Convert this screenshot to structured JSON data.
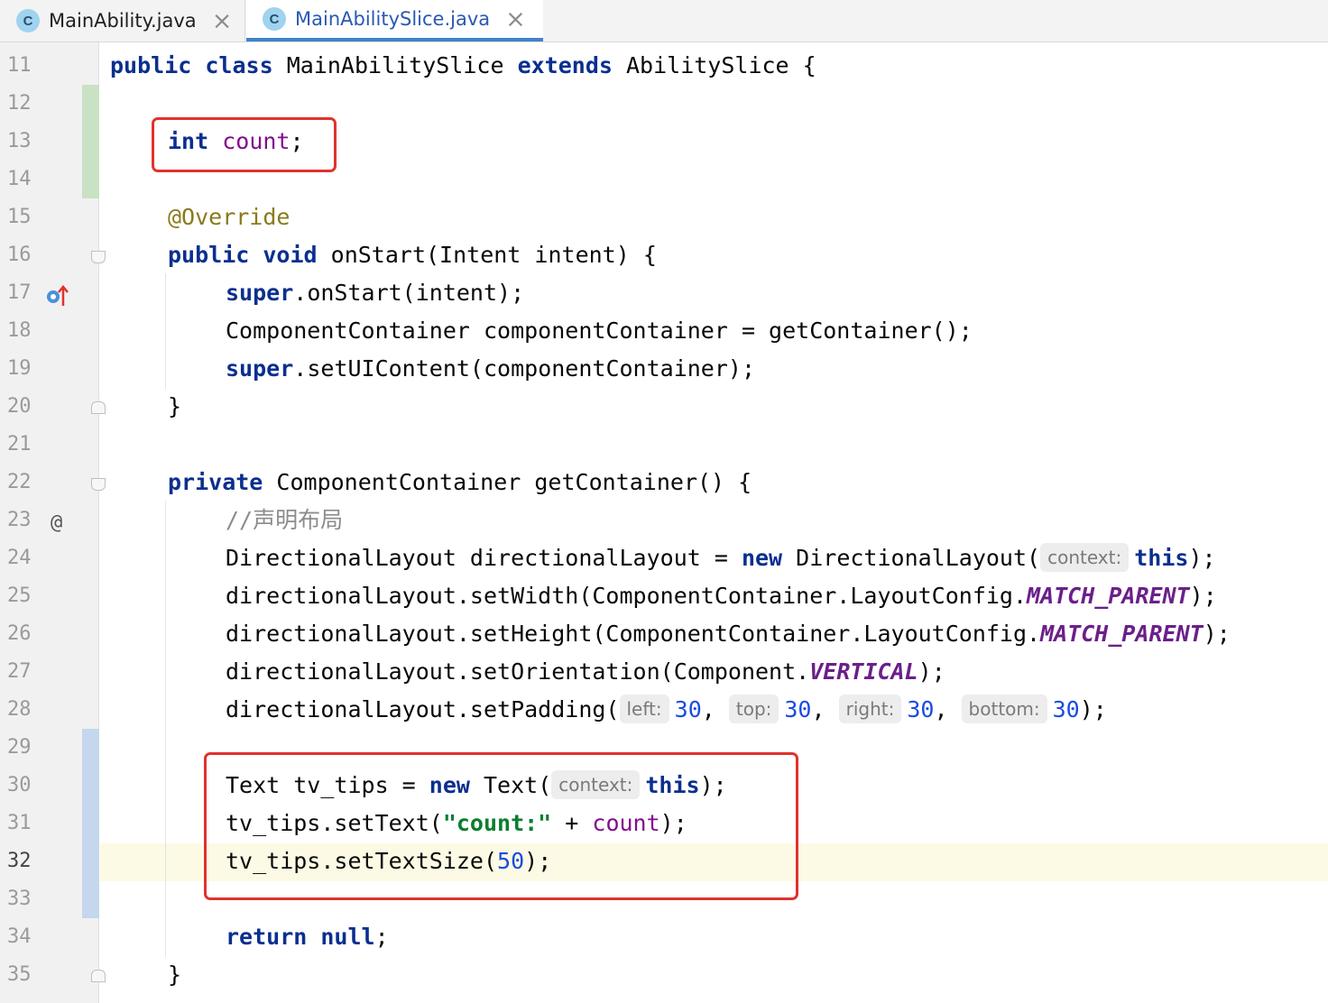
{
  "tabs": [
    {
      "label": "MainAbility.java",
      "icon": "C",
      "active": false
    },
    {
      "label": "MainAbilitySlice.java",
      "icon": "C",
      "active": true
    }
  ],
  "line_numbers": [
    "11",
    "12",
    "13",
    "14",
    "15",
    "16",
    "17",
    "18",
    "19",
    "20",
    "21",
    "22",
    "23",
    "24",
    "25",
    "26",
    "27",
    "28",
    "29",
    "30",
    "31",
    "32",
    "33",
    "34",
    "35"
  ],
  "gutter": {
    "implements_marker": "@"
  },
  "code": {
    "l11": {
      "kw_public": "public",
      "kw_class": "class",
      "class_name": " MainAbilitySlice ",
      "kw_extends": "extends",
      "rest": " AbilitySlice {"
    },
    "l13": {
      "kw_int": "int",
      "field": "count",
      "rest": ";"
    },
    "l15": {
      "annotation": "@Override"
    },
    "l16": {
      "kw_public": "public",
      "kw_void": "void",
      "rest": " onStart(Intent intent) {"
    },
    "l17": {
      "kw_super": "super",
      "rest": ".onStart(intent);"
    },
    "l18": {
      "text": "ComponentContainer componentContainer = getContainer();"
    },
    "l19": {
      "kw_super": "super",
      "rest": ".setUIContent(componentContainer);"
    },
    "l20": {
      "text": "}"
    },
    "l22": {
      "kw_private": "private",
      "rest": " ComponentContainer getContainer() {"
    },
    "l23": {
      "comment": "//声明布局"
    },
    "l24": {
      "pre": "DirectionalLayout directionalLayout = ",
      "kw_new": "new",
      "mid": " DirectionalLayout(",
      "hint": "context:",
      "kw_this": "this",
      "rest": ");"
    },
    "l25": {
      "pre": "directionalLayout.setWidth(ComponentContainer.LayoutConfig.",
      "const": "MATCH_PARENT",
      "rest": ");"
    },
    "l26": {
      "pre": "directionalLayout.setHeight(ComponentContainer.LayoutConfig.",
      "const": "MATCH_PARENT",
      "rest": ");"
    },
    "l27": {
      "pre": "directionalLayout.setOrientation(Component.",
      "const": "VERTICAL",
      "rest": ");"
    },
    "l28": {
      "pre": "directionalLayout.setPadding(",
      "hint_left": "left:",
      "v1": "30",
      "hint_top": "top:",
      "v2": "30",
      "hint_right": "right:",
      "v3": "30",
      "hint_bottom": "bottom:",
      "v4": "30",
      "rest": ");"
    },
    "l30": {
      "pre": "Text tv_tips = ",
      "kw_new": "new",
      "mid": " Text(",
      "hint": "context:",
      "kw_this": "this",
      "rest": ");"
    },
    "l31": {
      "pre": "tv_tips.setText(",
      "string": "\"count:\"",
      "mid": " + ",
      "field": "count",
      "rest": ");"
    },
    "l32": {
      "pre": "tv_tips.setTextSize(",
      "num": "50",
      "rest": ");"
    },
    "l34": {
      "kw_return": "return",
      "kw_null": "null",
      "rest": ";"
    },
    "l35": {
      "text": "}"
    }
  }
}
